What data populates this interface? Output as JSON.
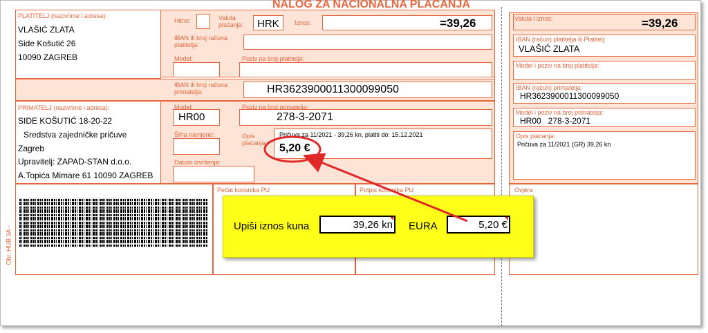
{
  "form": {
    "title": "NALOG ZA NACIONALNA PLAĆANJA",
    "side_code": "Obr. HUB 3A -"
  },
  "payer": {
    "label": "PLATITELJ (naziv/ime i adresa):",
    "name": "VLAŠIĆ ZLATA",
    "street": "Side Košutić 26",
    "city": "10090 ZAGREB"
  },
  "header": {
    "hitno_label": "Hitno:",
    "currency_label": "Valuta plaćanja:",
    "currency": "HRK",
    "amount_label": "Iznos:",
    "amount": "=39,26"
  },
  "payer_account": {
    "iban_label": "IBAN ili broj računa platitelja:",
    "model_label": "Model:",
    "reference_label": "Poziv na broj platitelja:"
  },
  "payee_account": {
    "iban_label": "IBAN ili broj računa primatelja:",
    "iban": "HR3623900011300099050"
  },
  "payee": {
    "label": "PRIMATELJ (naziv/ime i adresa):",
    "line1": "SIDE KOŠUTIĆ 18-20-22",
    "line2": "Sredstva zajedničke pričuve",
    "line3": "Zagreb",
    "line4": "Upravitelj: ZAPAD-STAN d.o.o.",
    "line5": "A.Topića Mimare 61 10090 ZAGREB"
  },
  "payee_ref": {
    "model_label": "Model:",
    "model": "HR00",
    "reference_label": "Poziv na broj primatelja:",
    "reference": "278-3-2071"
  },
  "purpose": {
    "code_label": "Šifra namjene:",
    "description_label": "Opis plaćanja:",
    "description": "Pričuva za 11/2021 - 39,26 kn, platiti do: 15.12.2021",
    "highlight": "5,20 €",
    "date_label": "Datum izvršenja:"
  },
  "bottom": {
    "stamp_label": "Pečat korisnika PU",
    "signature_label": "Potpis korisnika PU"
  },
  "receipt": {
    "currency_amount_label": "Valuta i iznos:",
    "amount": "=39,26",
    "payer_label": "IBAN (račun) platitelja ili Platitelj:",
    "payer_value": "VLAŠIĆ ZLATA",
    "model_ref_payer_label": "Model i poziv na broj platitelja:",
    "payee_iban_label": "IBAN (račun) primatelja:",
    "payee_iban": "HR3623900011300099050",
    "model_ref_payee_label": "Model i poziv na broj primatelja:",
    "model_ref_payee": "HR00   278-3-2071",
    "description_label": "Opis plaćanja:",
    "description": "Pričuva za 11/2021 (GR) 39,26 kn",
    "certification_label": "Ovjera"
  },
  "converter": {
    "kuna_label": "Upiši iznos kuna",
    "kuna_value": "39,26 kn",
    "eur_label": "EURA",
    "eur_value": "5,20 €"
  },
  "colors": {
    "form_accent": "#e8663c",
    "field_fill": "#fde4d6",
    "converter_bg": "#ffff1a",
    "arrow": "#e02828"
  }
}
